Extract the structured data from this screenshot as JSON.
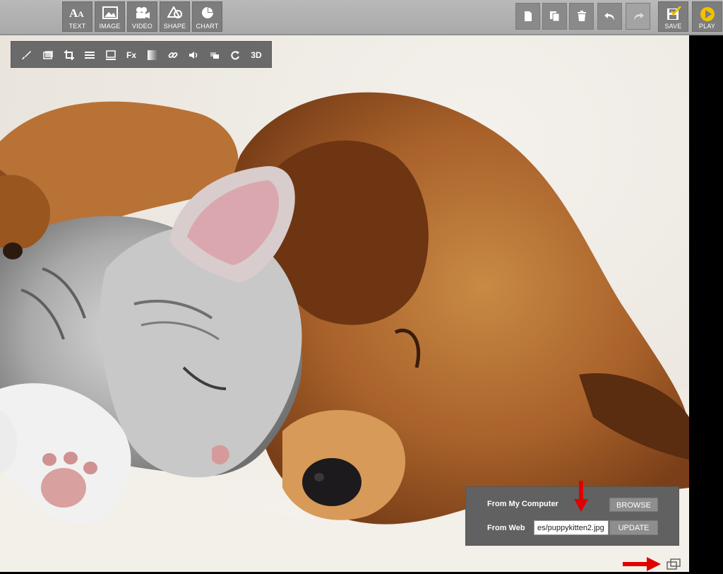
{
  "toolbar": {
    "insert": [
      {
        "label": "TEXT",
        "icon": "text-icon"
      },
      {
        "label": "IMAGE",
        "icon": "image-icon"
      },
      {
        "label": "VIDEO",
        "icon": "video-camera-icon"
      },
      {
        "label": "SHAPE",
        "icon": "shape-icon"
      },
      {
        "label": "CHART",
        "icon": "pie-chart-icon"
      }
    ],
    "actions": [
      {
        "icon": "new-page-icon"
      },
      {
        "icon": "duplicate-page-icon"
      },
      {
        "icon": "trash-icon"
      },
      {
        "icon": "undo-icon"
      },
      {
        "icon": "redo-icon"
      }
    ],
    "save_label": "SAVE",
    "play_label": "PLAY"
  },
  "image_toolbar": {
    "tools": [
      "brush-icon",
      "image-swap-icon",
      "crop-icon",
      "align-icon",
      "border-icon",
      "effects-icon",
      "gradient-icon",
      "link-icon",
      "sound-icon",
      "layer-order-icon",
      "rotate-icon",
      "3d-icon"
    ],
    "fx_label": "Fx",
    "three_d_label": "3D"
  },
  "upload_panel": {
    "from_computer_label": "From My Computer",
    "browse_label": "BROWSE",
    "from_web_label": "From Web",
    "url_value": "es/puppykitten2.jpg",
    "update_label": "UPDATE"
  },
  "colors": {
    "toolbar_bg": "#b0b0b0",
    "button_bg": "#7d7d7d",
    "panel_bg": "#616161",
    "arrow": "#e00000",
    "play_accent": "#f2c200"
  }
}
